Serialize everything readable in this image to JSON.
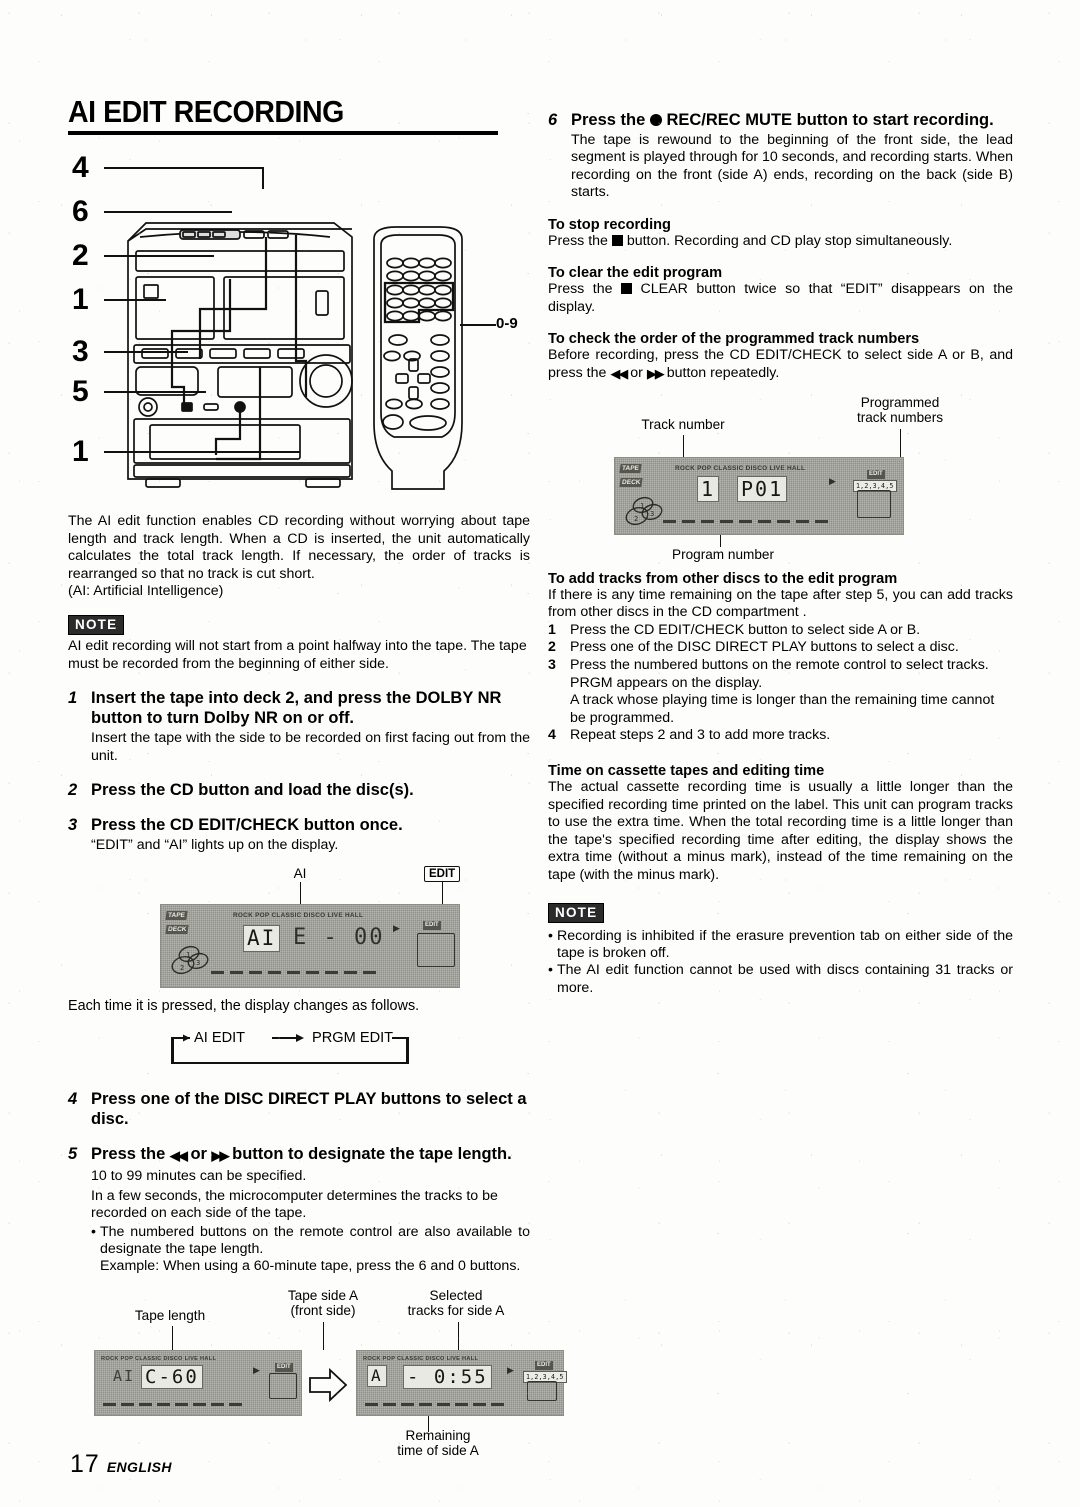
{
  "document": {
    "title": "AI EDIT RECORDING",
    "page_number": "17",
    "language": "ENGLISH"
  },
  "hero_diagram": {
    "callouts": [
      "4",
      "6",
      "2",
      "1",
      "3",
      "5",
      "1"
    ],
    "remote_label": "0-9"
  },
  "intro": {
    "paragraph": "The AI edit function enables CD recording without worrying about tape length and track length.  When a CD is inserted, the unit automatically calculates the total track length.  If necessary, the order of tracks is rearranged so that no track is cut short.",
    "paragraph_line2": "(AI: Artificial Intelligence)"
  },
  "note_left": {
    "badge": "NOTE",
    "text": "AI edit recording will not start from a point halfway into the tape. The tape must be recorded from the beginning of either side."
  },
  "steps": [
    {
      "num": "1",
      "head": "Insert the tape into deck 2, and press the DOLBY NR button to turn Dolby NR on or off.",
      "sub": "Insert the tape with the side to be recorded on first facing out from the unit."
    },
    {
      "num": "2",
      "head": "Press the CD button and load the disc(s).",
      "sub": ""
    },
    {
      "num": "3",
      "head": "Press the CD EDIT/CHECK button once.",
      "sub": "“EDIT” and “AI” lights up on the display."
    },
    {
      "num": "4",
      "head": "Press one of the DISC DIRECT PLAY buttons to select a disc.",
      "sub": ""
    },
    {
      "num": "5",
      "head_a": "Press the ",
      "head_b": " or ",
      "head_c": " button to designate the tape length.",
      "sub1": "10 to 99 minutes can be specified.",
      "sub2": "In a few seconds, the microcomputer determines the tracks to be recorded on each side of the tape.",
      "bullet1": "The numbered buttons on the remote control are also available to designate the tape length.",
      "bullet2": "Example:  When using a 60-minute tape, press the 6 and 0 buttons."
    }
  ],
  "display_step3": {
    "label_ai": "AI",
    "label_edit": "EDIT",
    "modes": "ROCK    POP   CLASSIC   DISCO   LIVE   HALL",
    "tag_top": "TAPE",
    "tag_bottom": "DECK",
    "segment_left": "AI",
    "segment_main": "E - 00",
    "mini_edit": "EDIT",
    "caption": "Each time it is pressed, the display changes as follows."
  },
  "flow": {
    "from": "AI EDIT",
    "to": "PRGM EDIT",
    "arrow": "⟶"
  },
  "display_bottom": {
    "label_tape_length": "Tape length",
    "label_tape_side_a": "Tape side A",
    "label_front_side": "(front side)",
    "label_selected": "Selected",
    "label_tracks_side_a": "tracks for side A",
    "label_remaining": "Remaining",
    "label_time_side_a": "time of side A",
    "modes": "ROCK   POP  CLASSIC  DISCO  LIVE  HALL",
    "left_seg_small": "AI",
    "left_seg_main": "C-60",
    "right_seg_small": "A",
    "right_seg_main": "- 0:55",
    "right_tracknums": "1,2,3,4,5",
    "mini_edit": "EDIT"
  },
  "right_column": {
    "step6": {
      "num": "6",
      "head_a": "Press  the ",
      "head_b": "  REC/REC  MUTE  button  to  start recording.",
      "body": "The tape is rewound to the beginning of the front side, the lead segment is played through for 10 seconds, and recording starts.  When recording on the front (side A) ends, recording on the back (side B) starts."
    },
    "stop_recording": {
      "head": "To stop recording",
      "body_a": "Press the ",
      "body_b": " button. Recording and CD play stop simultaneously."
    },
    "clear_program": {
      "head": "To clear the edit program",
      "body_a": "Press the ",
      "body_b": " CLEAR button twice so that “EDIT” disappears on the display."
    },
    "check_order": {
      "head": "To check the order of the programmed track numbers",
      "body_a": "Before recording, press the CD EDIT/CHECK to select side A or B, and press the ",
      "body_b": " or ",
      "body_c": " button repeatedly."
    },
    "display_check": {
      "label_track_number": "Track number",
      "label_programmed": "Programmed",
      "label_track_numbers": "track numbers",
      "label_program_number": "Program number",
      "modes": "ROCK   POP  CLASSIC  DISCO  LIVE  HALL",
      "seg_small": "1",
      "seg_main": "P01",
      "tracknums": "1,2,3,4,5",
      "mini_edit": "EDIT"
    },
    "add_tracks": {
      "head": "To add tracks from other discs to the edit program",
      "intro": "If there is any time remaining on the tape after step 5, you can add tracks from other discs in the CD compartment .",
      "items": [
        {
          "n": "1",
          "text": "Press the CD EDIT/CHECK button to select side A or B."
        },
        {
          "n": "2",
          "text": "Press one of the DISC DIRECT PLAY buttons to select a disc."
        },
        {
          "n": "3",
          "text": "Press the numbered buttons on the remote control to select tracks.  PRGM  appears on the display."
        },
        {
          "n": "",
          "text": "A track whose playing time is longer than the remaining time cannot be programmed."
        },
        {
          "n": "4",
          "text": "Repeat steps 2 and 3 to add more tracks."
        }
      ]
    },
    "time_on_tapes": {
      "head": "Time on cassette tapes and editing time",
      "body": "The actual cassette recording time is usually a little longer than the specified recording time printed on the label.  This unit can program tracks to use the extra time.  When the total recording time is a little longer than the tape's specified recording time after editing, the display shows the extra time (without a minus mark), instead of the time remaining on the tape (with the minus mark)."
    },
    "note": {
      "badge": "NOTE",
      "bullets": [
        "Recording is inhibited if the erasure prevention tab on either side of the tape is broken off.",
        "The AI edit function cannot be used with discs containing 31 tracks or more."
      ]
    }
  },
  "colors": {
    "ink": "#000000",
    "paper": "#fdfdfb",
    "lcd": "#b4b4ae"
  }
}
